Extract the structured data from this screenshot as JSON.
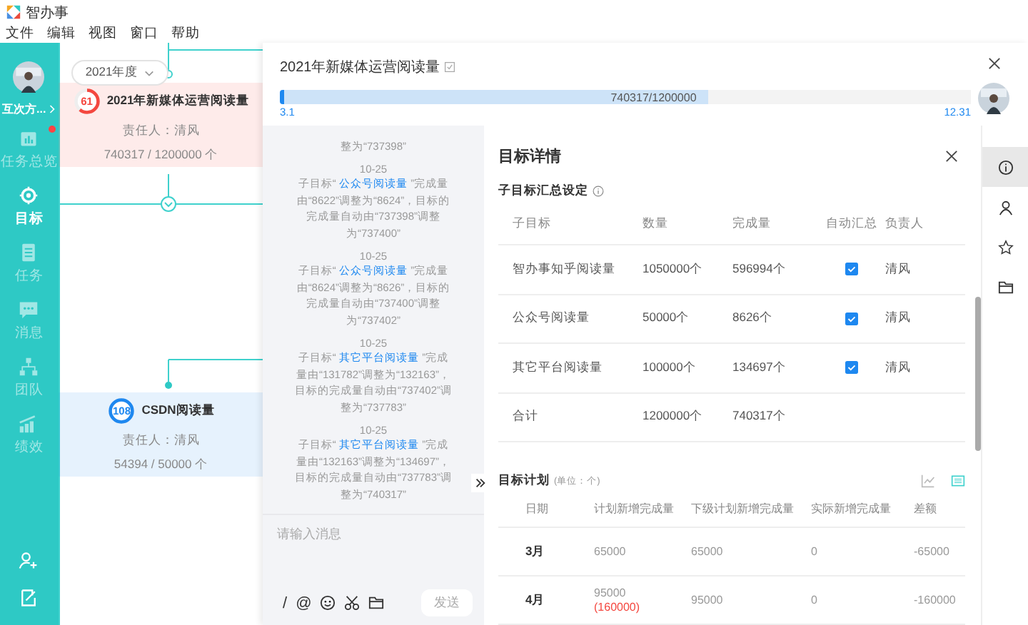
{
  "app": {
    "name": "智办事"
  },
  "menu": [
    "文件",
    "编辑",
    "视图",
    "窗口",
    "帮助"
  ],
  "sidebar": {
    "user": "互次方...",
    "items": [
      {
        "kind": "overview",
        "label": "任务总览",
        "selected": false,
        "dot": true
      },
      {
        "kind": "target",
        "label": "目标",
        "selected": true,
        "dot": false
      },
      {
        "kind": "task",
        "label": "任务",
        "selected": false,
        "dot": false
      },
      {
        "kind": "message",
        "label": "消息",
        "selected": false,
        "dot": false
      },
      {
        "kind": "team",
        "label": "团队",
        "selected": false,
        "dot": false
      },
      {
        "kind": "perf",
        "label": "绩效",
        "selected": false,
        "dot": false
      }
    ]
  },
  "canvas": {
    "year": "2021年度",
    "goals": [
      {
        "progress": "61",
        "level": 0.61,
        "color": "#f4473f",
        "title": "2021年新媒体运营阅读量",
        "owner": "责任人：清风",
        "amount": "740317 / 1200000 个"
      },
      {
        "progress": "108",
        "level": 1,
        "color": "#1e88f0",
        "title": "CSDN阅读量",
        "owner": "责任人：清风",
        "amount": "54394 / 50000 个"
      }
    ]
  },
  "goal": {
    "title": "2021年新媒体运营阅读量",
    "progress_text": "740317/1200000",
    "level": 0.617,
    "start": "3.1",
    "end": "12.31"
  },
  "log": {
    "entries": [
      {
        "text": "整为“737398”"
      },
      {
        "date": "10-25",
        "prefix": "子目标“ ",
        "link": "公众号阅读量",
        "suffix": " ”完成量由“8622”调整为“8624”，目标的完成量自动由“737398”调整为“737400”"
      },
      {
        "date": "10-25",
        "prefix": "子目标“ ",
        "link": "公众号阅读量",
        "suffix": " ”完成量由“8624”调整为“8626”，目标的完成量自动由“737400”调整为“737402”"
      },
      {
        "date": "10-25",
        "prefix": "子目标“ ",
        "link": "其它平台阅读量",
        "suffix": " ”完成量由“131782”调整为“132163”，目标的完成量自动由“737402”调整为“737783”"
      },
      {
        "date": "10-25",
        "prefix": "子目标“ ",
        "link": "其它平台阅读量",
        "suffix": " ”完成量由“132163”调整为“134697”，目标的完成量自动由“737783”调整为“740317”"
      }
    ],
    "placeholder": "请输入消息",
    "tools": [
      {
        "kind": "text",
        "char": "/"
      },
      {
        "kind": "text",
        "char": "@"
      },
      {
        "kind": "emoji"
      },
      {
        "kind": "scissors"
      },
      {
        "kind": "folder"
      }
    ],
    "send": "发送"
  },
  "detail": {
    "title": "目标详情",
    "sub_title": "子目标汇总设定",
    "sub_columns": [
      "子目标",
      "数量",
      "完成量",
      "自动汇总",
      "负责人"
    ],
    "sub_rows": [
      {
        "kind": "item",
        "name": "智办事知乎阅读量",
        "amount": "1050000个",
        "done": "596994个",
        "checked": true,
        "owner": "清风"
      },
      {
        "kind": "item",
        "name": "公众号阅读量",
        "amount": "50000个",
        "done": "8626个",
        "checked": true,
        "owner": "清风"
      },
      {
        "kind": "item",
        "name": "其它平台阅读量",
        "amount": "100000个",
        "done": "134697个",
        "checked": true,
        "owner": "清风"
      },
      {
        "kind": "total",
        "name": "合计",
        "amount": "1200000个",
        "done": "740317个"
      }
    ],
    "plan_title": "目标计划",
    "plan_unit": "(单位：个)",
    "views": [
      {
        "kind": "chart",
        "selected": false
      },
      {
        "kind": "table",
        "selected": true
      }
    ],
    "plan_columns": [
      "日期",
      "计划新增完成量",
      "下级计划新增完成量",
      "实际新增完成量",
      "差额"
    ],
    "plan_rows": [
      {
        "month": "3月",
        "planned": "65000",
        "sub": "65000",
        "actual": "0",
        "diff": "-65000"
      },
      {
        "month": "4月",
        "planned": "95000",
        "planned_note": "(160000)",
        "sub": "95000",
        "actual": "0",
        "diff": "-160000"
      }
    ]
  },
  "rail": [
    {
      "kind": "info",
      "selected": true
    },
    {
      "kind": "person",
      "selected": false
    },
    {
      "kind": "star",
      "selected": false
    },
    {
      "kind": "folder",
      "selected": false
    }
  ]
}
